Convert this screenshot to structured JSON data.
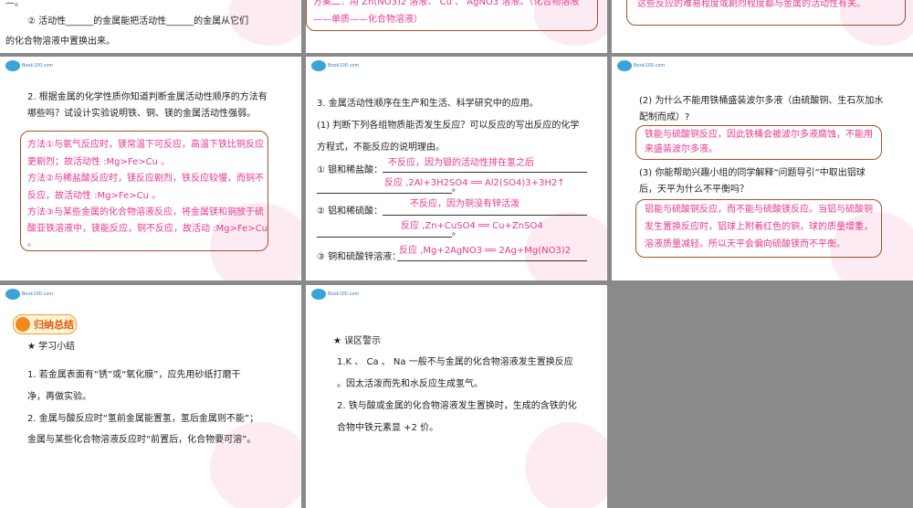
{
  "s1": {
    "top": "—。",
    "line1": "② 活动性______的金属能把活动性______的金属从它们",
    "line2": "的化合物溶液中置换出来。"
  },
  "s2": {
    "line1": "方案二：用 Zn(NO3)2 溶液、 Cu 、 AgNO3 溶液。（化合物溶液",
    "line2": "——单质——化合物溶液）"
  },
  "s3": {
    "line1": "这些反应的难易程度或剧烈程度都与金属的活动性有关。"
  },
  "s4": {
    "q1": "2. 根据金属的化学性质你知道判断金属活动性顺序的方法有",
    "q2": "哪些吗？试设计实验说明铁、铜、镁的金属活动性强弱。",
    "a1": "方法①与氧气反应时，镁常温下可反应，高温下铁比铜反应",
    "a2": "更剧烈；故活动性 :Mg>Fe>Cu 。",
    "a3": "方法②与稀盐酸反应时，镁反应剧烈，铁反应较慢，而铜不",
    "a4": "反应，故活动性 :Mg>Fe>Cu 。",
    "a5": "方法③与某些金属的化合物溶液反应，将金属镁和铜放于硫",
    "a6": "酸亚铁溶液中，镁能反应，铜不反应，故活动 :Mg>Fe>Cu",
    "a7": "。"
  },
  "s5": {
    "h": "3. 金属活动性顺序在生产和生活、科学研究中的应用。",
    "q1": "(1) 判断下列各组物质能否发生反应？可以反应的写出反应的化学",
    "q2": "方程式，不能反应的说明理由。",
    "i1": "① 银和稀盐酸：",
    "r1": "不反应，因为银的活动性排在氢之后",
    "r2": "反应 ,2Al+3H2SO4 ══ Al2(SO4)3+3H2↑",
    "dot1": "。",
    "i2": "② 铝和稀硫酸：",
    "r3": "不反应，因为铜没有锌活泼",
    "r4": "反应 ,Zn+CuSO4 ══ Cu+ZnSO4",
    "dot2": "。",
    "i3": "③ 铜和硫酸锌溶液：",
    "r5": "反应 ,Mg+2AgNO3 ══ 2Ag+Mg(NO3)2"
  },
  "s6": {
    "q1": "(2) 为什么不能用铁桶盛装波尔多液（由硫酸铜、生石灰加水",
    "q2": "配制而成）?",
    "a1": "铁能与硫酸铜反应，因此铁桶会被波尔多液腐蚀，不能用",
    "a2": "来盛装波尔多液。",
    "q3": "(3) 你能帮助兴趣小组的同学解释“问题导引”中取出铝球",
    "q4": "后，天平为什么不平衡吗？",
    "b1": "铝能与硫酸铜反应，而不能与硫酸镁反应。当铝与硫酸铜",
    "b2": "发生置换反应时，铝球上附着红色的铜，球的质量增重，",
    "b3": "溶液质量减轻。所以天平会偏向硫酸镁而不平衡。"
  },
  "s7": {
    "badge": "归纳总结",
    "h": "★ 学习小结",
    "l1": "1. 若金属表面有“锈”或“氧化膜”，应先用砂纸打磨干",
    "l2": "净，再做实验。",
    "l3": "2. 金属与酸反应时“氢前金属能置氢，氢后金属则不能”；",
    "l4": "金属与某些化合物溶液反应时“前置后，化合物要可溶”。"
  },
  "s8": {
    "h": "★ 误区警示",
    "l1": "1.K 、 Ca 、 Na 一般不与金属的化合物溶液发生置换反应",
    "l2": "。因太活泼而先和水反应生成氢气。",
    "l3": "2. 铁与酸或金属的化合物溶液发生置换时，生成的含铁的化",
    "l4": "合物中铁元素显 +2 价。"
  },
  "logo": {
    "text": "Book100.com"
  }
}
